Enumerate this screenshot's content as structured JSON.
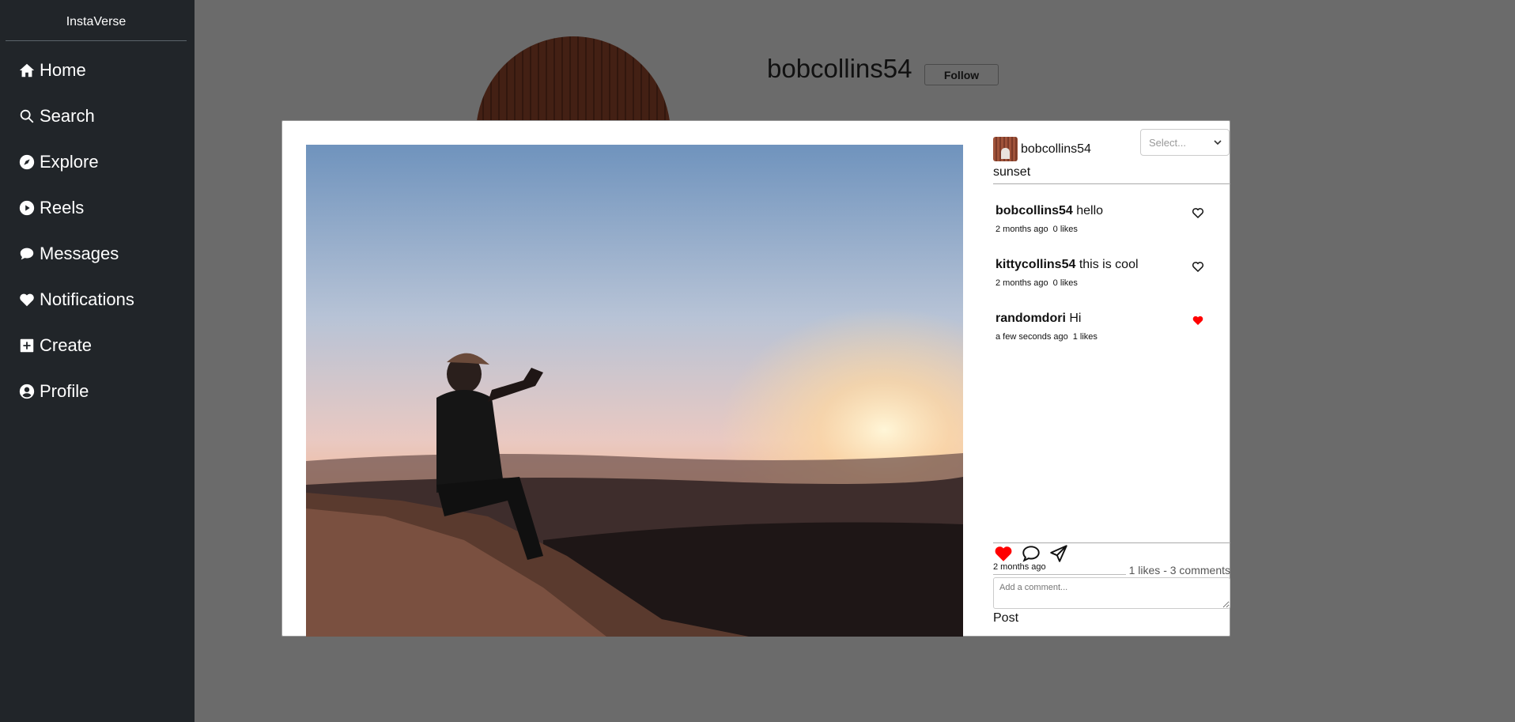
{
  "app": {
    "brand": "InstaVerse"
  },
  "sidebar": {
    "items": [
      {
        "label": "Home",
        "icon": "home-icon"
      },
      {
        "label": "Search",
        "icon": "search-icon"
      },
      {
        "label": "Explore",
        "icon": "compass-icon"
      },
      {
        "label": "Reels",
        "icon": "play-circle-icon"
      },
      {
        "label": "Messages",
        "icon": "chat-bubble-icon"
      },
      {
        "label": "Notifications",
        "icon": "heart-icon"
      },
      {
        "label": "Create",
        "icon": "plus-square-icon"
      },
      {
        "label": "Profile",
        "icon": "person-circle-icon"
      }
    ]
  },
  "profile": {
    "username": "bobcollins54",
    "follow_label": "Follow"
  },
  "post": {
    "username": "bobcollins54",
    "select_placeholder": "Select...",
    "caption": "sunset",
    "comments": [
      {
        "user": "bobcollins54",
        "text": "hello",
        "time": "2 months ago",
        "likes": "0 likes",
        "liked": false
      },
      {
        "user": "kittycollins54",
        "text": "this is cool",
        "time": "2 months ago",
        "likes": "0 likes",
        "liked": false
      },
      {
        "user": "randomdori",
        "text": "Hi",
        "time": "a few seconds ago",
        "likes": "1 likes",
        "liked": true
      }
    ],
    "liked": true,
    "date": "2 months ago",
    "stats": "1 likes - 3 comments",
    "comment_placeholder": "Add a comment...",
    "post_label": "Post"
  },
  "colors": {
    "sidebar_bg": "#212529",
    "like_red": "#ff0000",
    "overlay": "#6b6b6b"
  }
}
